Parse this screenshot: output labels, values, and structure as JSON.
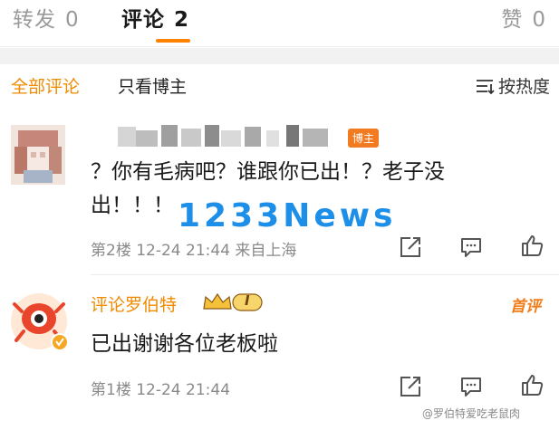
{
  "tabs": {
    "repost": {
      "label": "转发",
      "count": "0"
    },
    "comment": {
      "label": "评论",
      "count": "2"
    },
    "like": {
      "label": "赞",
      "count": "0"
    }
  },
  "filter": {
    "all": "全部评论",
    "blogger_only": "只看博主",
    "sort": "按热度"
  },
  "comments": [
    {
      "badge": "博主",
      "text": "？你有毛病吧？谁跟你已出！？老子没出！！！",
      "meta": "第2楼  12-24  21:44  来自上海"
    },
    {
      "name": "评论罗伯特",
      "level": "I",
      "tag": "首评",
      "text": "已出谢谢各位老板啦",
      "meta": "第1楼  12-24  21:44"
    }
  ],
  "watermark": "1233News",
  "credit": "@罗伯特爱吃老鼠肉",
  "colors": {
    "accent": "#ff8200",
    "watermark": "#1d8fe8",
    "muted": "#8a8a8a"
  },
  "icons": [
    "sort-icon",
    "share-icon",
    "comment-icon",
    "like-icon",
    "vip-crown-icon",
    "verified-icon"
  ]
}
